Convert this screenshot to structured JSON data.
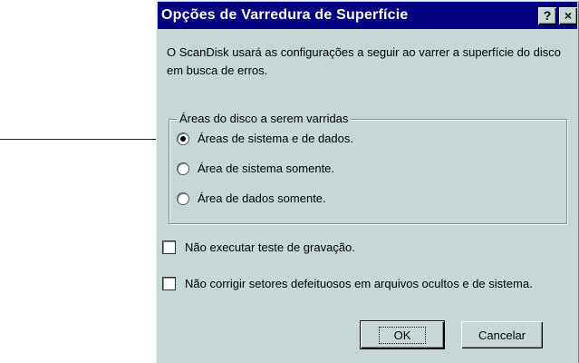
{
  "dialog": {
    "title": "Opções de Varredura de Superfície",
    "help_button": "?",
    "close_button": "×",
    "intro_text": "O ScanDisk usará as configurações a seguir ao varrer a superfície do disco em busca de erros."
  },
  "areas_group": {
    "legend": "Áreas do disco a serem varridas",
    "options": [
      {
        "label": "Áreas de sistema e de dados.",
        "selected": true
      },
      {
        "label": "Área de sistema somente.",
        "selected": false
      },
      {
        "label": "Área de dados somente.",
        "selected": false
      }
    ]
  },
  "checkboxes": [
    {
      "label": "Não executar teste de gravação.",
      "checked": false
    },
    {
      "label": "Não corrigir setores defeituosos em arquivos ocultos e de sistema.",
      "checked": false
    }
  ],
  "buttons": {
    "ok": "OK",
    "cancel": "Cancelar"
  }
}
